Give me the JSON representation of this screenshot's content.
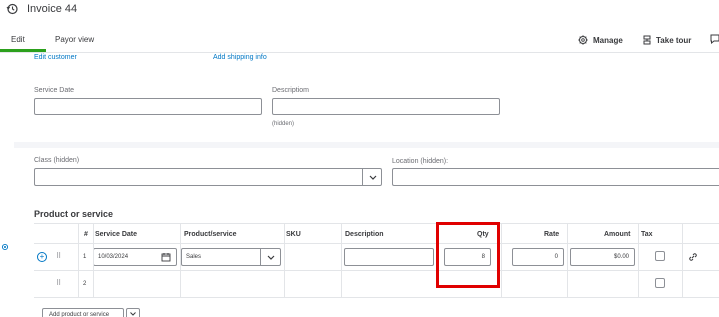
{
  "header": {
    "title": "Invoice 44"
  },
  "tabs": {
    "edit": "Edit",
    "payor": "Payor view"
  },
  "toolbar": {
    "manage": "Manage",
    "take_tour": "Take tour"
  },
  "customer": {
    "edit_customer": "Edit customer",
    "add_shipping": "Add shipping info"
  },
  "fields": {
    "service_date_label": "Service Date",
    "service_date_value": "",
    "description_label": "Descriptiom",
    "description_value": "",
    "description_note": "(hidden)",
    "class_label": "Class (hidden)",
    "class_value": "",
    "location_label": "Location (hidden):",
    "location_value": ""
  },
  "section": {
    "title": "Product or service"
  },
  "table": {
    "headers": {
      "num": "#",
      "service_date": "Service Date",
      "product": "Product/service",
      "sku": "SKU",
      "description": "Description",
      "qty": "Qty",
      "rate": "Rate",
      "amount": "Amount",
      "tax": "Tax"
    },
    "rows": [
      {
        "num": "1",
        "service_date": "10/03/2024",
        "product": "Sales",
        "sku": "",
        "description": "",
        "qty": "8",
        "rate": "0",
        "amount": "$0.00",
        "tax": false
      },
      {
        "num": "2"
      }
    ]
  },
  "footer": {
    "add_product": "Add product or service"
  },
  "colors": {
    "accent": "#2ca01c",
    "link": "#0077c5",
    "highlight": "#e00000"
  },
  "icons": [
    "history-icon",
    "gear-icon",
    "tour-icon",
    "chat-icon",
    "chevron-down-icon",
    "calendar-icon",
    "plus-circle-icon",
    "drag-handle-icon",
    "link-icon"
  ]
}
